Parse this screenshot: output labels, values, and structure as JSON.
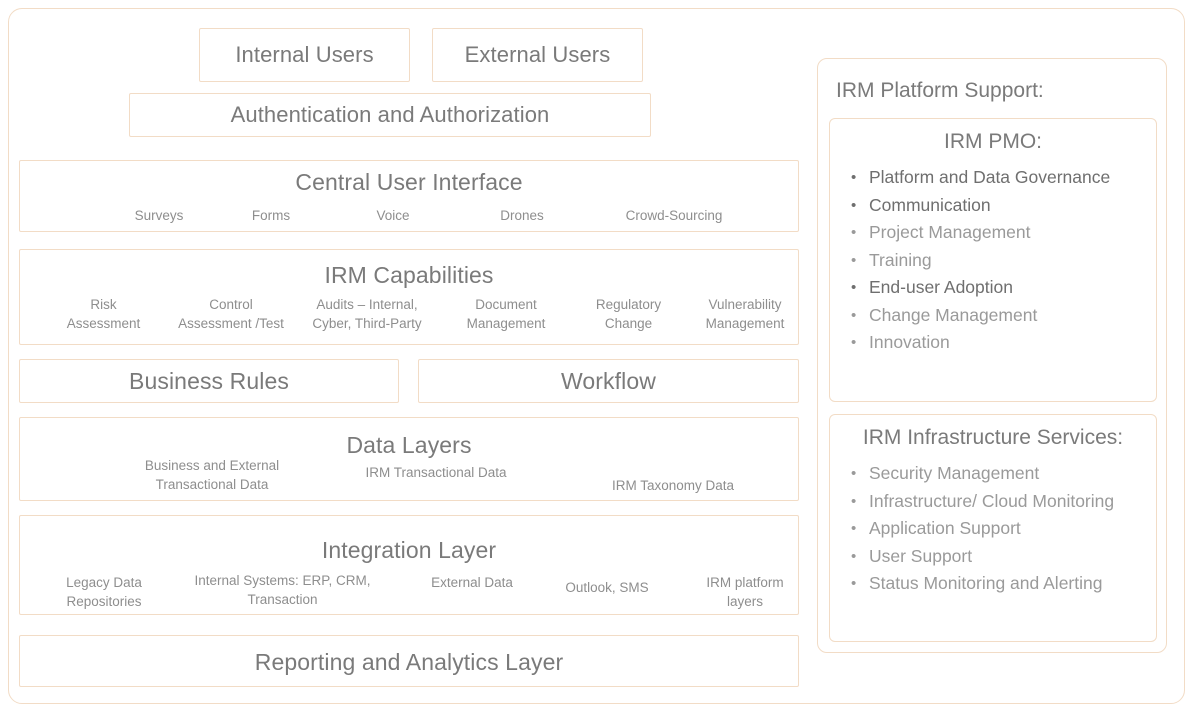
{
  "diagram": {
    "accent_border_color": "#f2dcc6",
    "text_color": "#7a7a7a",
    "muted_text_color": "#8e8e8e",
    "background_color": "#ffffff"
  },
  "left": {
    "users": {
      "internal": "Internal Users",
      "external": "External Users"
    },
    "auth": "Authentication and Authorization",
    "central_ui": {
      "title": "Central User Interface",
      "items": [
        "Surveys",
        "Forms",
        "Voice",
        "Drones",
        "Crowd-Sourcing"
      ]
    },
    "capabilities": {
      "title": "IRM Capabilities",
      "items": [
        "Risk\nAssessment",
        "Control\nAssessment /Test",
        "Audits – Internal,\nCyber, Third-Party",
        "Document\nManagement",
        "Regulatory\nChange",
        "Vulnerability\nManagement"
      ]
    },
    "business_rules": "Business Rules",
    "workflow": "Workflow",
    "data_layers": {
      "title": "Data Layers",
      "items": [
        "Business and External\nTransactional Data",
        "IRM Transactional Data",
        "IRM Taxonomy Data"
      ]
    },
    "integration_layer": {
      "title": "Integration Layer",
      "items": [
        "Legacy Data\nRepositories",
        "Internal Systems: ERP, CRM,\nTransaction",
        "External Data",
        "Outlook, SMS",
        "IRM platform\nlayers"
      ]
    },
    "reporting": "Reporting and Analytics Layer"
  },
  "right": {
    "heading": "IRM Platform Support:",
    "pmo": {
      "title": "IRM PMO:",
      "items": [
        {
          "label": "Platform and Data Governance",
          "emphasis": true
        },
        {
          "label": "Communication",
          "emphasis": true
        },
        {
          "label": "Project Management",
          "emphasis": false
        },
        {
          "label": "Training",
          "emphasis": false
        },
        {
          "label": "End-user Adoption",
          "emphasis": true
        },
        {
          "label": "Change Management",
          "emphasis": false
        },
        {
          "label": "Innovation",
          "emphasis": false
        }
      ]
    },
    "infrastructure": {
      "title": "IRM Infrastructure Services:",
      "items": [
        {
          "label": "Security Management",
          "emphasis": false
        },
        {
          "label": "Infrastructure/ Cloud Monitoring",
          "emphasis": false
        },
        {
          "label": "Application Support",
          "emphasis": false
        },
        {
          "label": "User Support",
          "emphasis": false
        },
        {
          "label": "Status Monitoring and Alerting",
          "emphasis": false
        }
      ]
    }
  }
}
